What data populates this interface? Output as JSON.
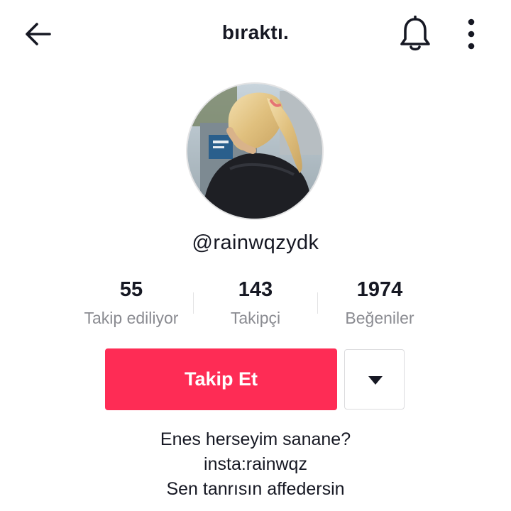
{
  "header": {
    "title": "bıraktı.",
    "back_icon": "arrow-left-icon",
    "notification_icon": "bell-icon",
    "more_icon": "more-vertical-icon"
  },
  "profile": {
    "avatar_alt": "profile photo",
    "username": "@rainwqzydk"
  },
  "stats": [
    {
      "value": "55",
      "label": "Takip ediliyor"
    },
    {
      "value": "143",
      "label": "Takipçi"
    },
    {
      "value": "1974",
      "label": "Beğeniler"
    }
  ],
  "actions": {
    "follow_label": "Takip Et",
    "dropdown_icon": "caret-down-icon"
  },
  "bio": {
    "lines": [
      "Enes herseyim sanane?",
      "insta:rainwqz",
      "Sen tanrısın affedersin"
    ]
  },
  "colors": {
    "accent": "#fe2c55",
    "text": "#161823",
    "muted": "#8a8b91"
  }
}
